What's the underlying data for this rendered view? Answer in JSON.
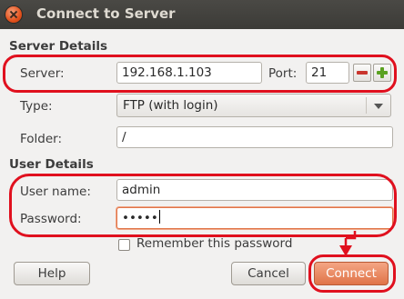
{
  "window": {
    "title": "Connect to Server"
  },
  "server_details": {
    "heading": "Server Details",
    "server_label": "Server:",
    "server_value": "192.168.1.103",
    "port_label": "Port:",
    "port_value": "21",
    "type_label": "Type:",
    "type_value": "FTP (with login)",
    "folder_label": "Folder:",
    "folder_value": "/"
  },
  "user_details": {
    "heading": "User Details",
    "username_label": "User name:",
    "username_value": "admin",
    "password_label": "Password:",
    "password_value": "•••••",
    "remember_label": "Remember this password",
    "remember_checked": false
  },
  "buttons": {
    "help": "Help",
    "cancel": "Cancel",
    "connect": "Connect"
  },
  "colors": {
    "accent": "#e07448",
    "highlight": "#e0101e",
    "titlebar": "#3c3b37"
  },
  "icons": {
    "close": "close-icon",
    "port_decrement": "minus-icon",
    "port_increment": "plus-icon",
    "type_dropdown": "chevron-down-icon"
  }
}
